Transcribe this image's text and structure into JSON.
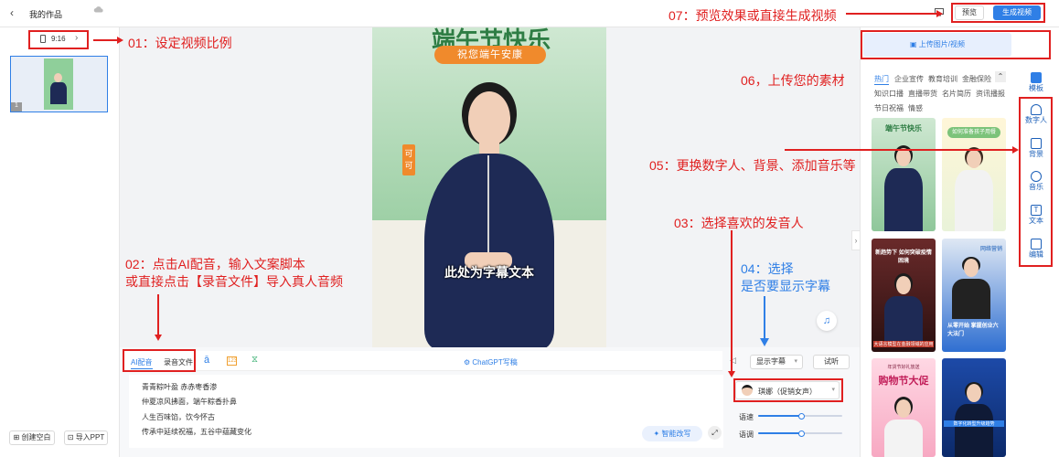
{
  "topbar": {
    "project_title": "我的作品",
    "preview_label": "预览",
    "generate_label": "生成视频"
  },
  "left": {
    "ratio_label": "9:16",
    "slide_number": "1",
    "create_blank_label": "创建空白",
    "import_ppt_label": "导入PPT"
  },
  "canvas": {
    "banner_title": "端午节快乐",
    "banner_subtitle": "祝您端午安康",
    "side_stamp_1": "可",
    "side_stamp_2": "可",
    "subtitle_placeholder": "此处为字幕文本"
  },
  "toolbar": {
    "ai_dub_label": "AI配音",
    "record_label": "录音文件",
    "chatgpt_label": "ChatGPT写稿",
    "subtitle_select": "显示字幕",
    "listen_label": "试听"
  },
  "script_lines": [
    "青青粽叶盈 赤赤枣香渗",
    "仲夏凉风拂面，端午粽香扑鼻",
    "人生百味馅，饮今怀古",
    "传承中延续祝福，五谷中蕴藏变化"
  ],
  "smart_rewrite_label": "智能改写",
  "voice": {
    "name": "琪娜（促销女声）",
    "speed_label": "语速",
    "pitch_label": "语调",
    "speed_level": 0.52,
    "pitch_level": 0.52
  },
  "right": {
    "upload_label": "上传图片/视频",
    "categories_row1": [
      "热门",
      "企业宣传",
      "教育培训",
      "金融保险"
    ],
    "categories_row2": [
      "知识口播",
      "直播带货",
      "名片简历",
      "资讯播报"
    ],
    "categories_row3": [
      "节日祝福",
      "情感"
    ],
    "templates": [
      {
        "title": "端午节快乐",
        "subtitle": ""
      },
      {
        "title": "如何准备孩子用餐",
        "subtitle": ""
      },
      {
        "title": "新趋势下 如何突破疫情困境",
        "subtitle": "大语言模型在金融领域的应用"
      },
      {
        "title": "网络营销",
        "subtitle": "从零开始 掌握创业六大法门"
      },
      {
        "title": "购物节大促",
        "subtitle": "年货节好礼放送"
      },
      {
        "title": "",
        "subtitle": "数字化转型升级趋势"
      }
    ],
    "side_tabs": [
      "模板",
      "数字人",
      "背景",
      "音乐",
      "文本",
      "编辑"
    ]
  },
  "annotations": {
    "a01": "01：设定视频比例",
    "a02_line1": "02：点击AI配音，输入文案脚本",
    "a02_line2": "或直接点击【录音文件】导入真人音频",
    "a03": "03：选择喜欢的发音人",
    "a04_line1": "04：选择",
    "a04_line2": "是否要显示字幕",
    "a05": "05：更换数字人、背景、添加音乐等",
    "a06": "06，上传您的素材",
    "a07": "07：预览效果或直接生成视频"
  },
  "colors": {
    "accent": "#2f7fe6",
    "annotation_red": "#e02020",
    "banner_green": "#5aa86a",
    "banner_orange": "#f08a2c"
  }
}
